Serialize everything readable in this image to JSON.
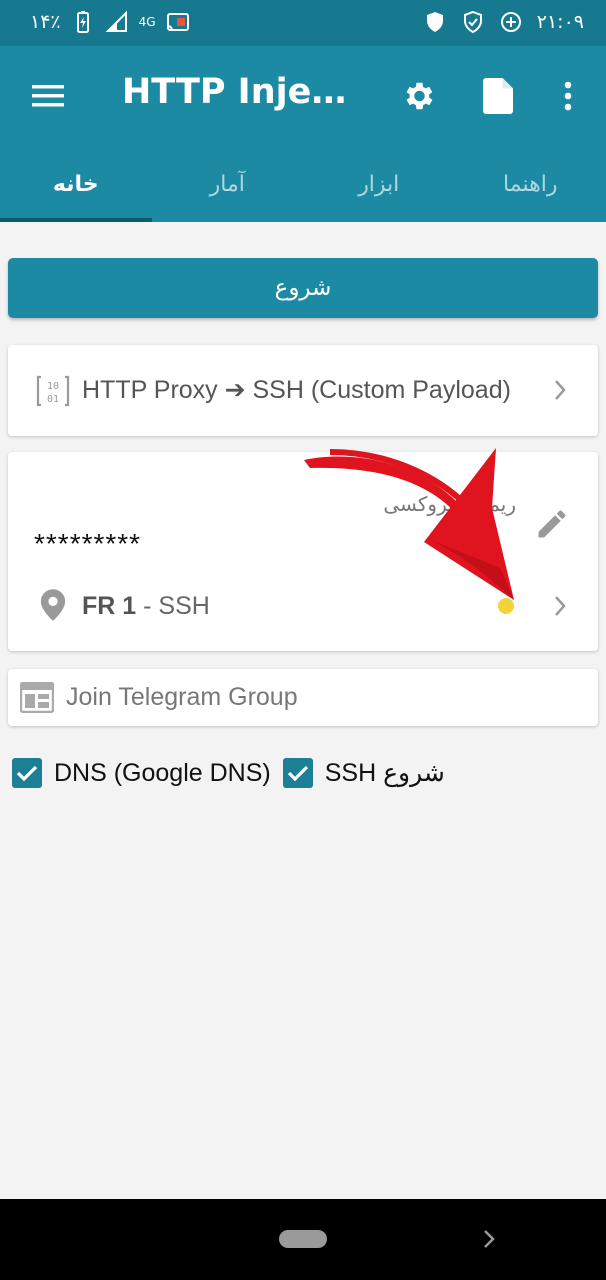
{
  "status_bar": {
    "battery_percent": "۱۴٪",
    "network": "4G",
    "time": "۲۱:۰۹"
  },
  "app_bar": {
    "title": "HTTP Injector",
    "icons": [
      "menu-icon",
      "gear-icon",
      "document-icon",
      "more-vert-icon"
    ]
  },
  "tabs": [
    {
      "label": "خانه",
      "active": true
    },
    {
      "label": "آمار",
      "active": false
    },
    {
      "label": "ابزار",
      "active": false
    },
    {
      "label": "راهنما",
      "active": false
    }
  ],
  "start_button": {
    "label": "شروع"
  },
  "mode_card": {
    "text": "HTTP Proxy ➔ SSH (Custom Payload)"
  },
  "server_card": {
    "remark": "ریموت پروکسی",
    "password": "*********",
    "server_code": "FR 1",
    "server_type": " - SSH",
    "status_color": "#f2d43a"
  },
  "telegram_card": {
    "placeholder": "Join Telegram Group"
  },
  "checkboxes": [
    {
      "label": "DNS (Google DNS)",
      "checked": true
    },
    {
      "label": "SSH شروع",
      "checked": true
    }
  ],
  "colors": {
    "primary": "#1c8aa3",
    "status_bar": "#17798f",
    "accent_dark": "#0d5a6c",
    "annotation_arrow": "#e0141e"
  }
}
